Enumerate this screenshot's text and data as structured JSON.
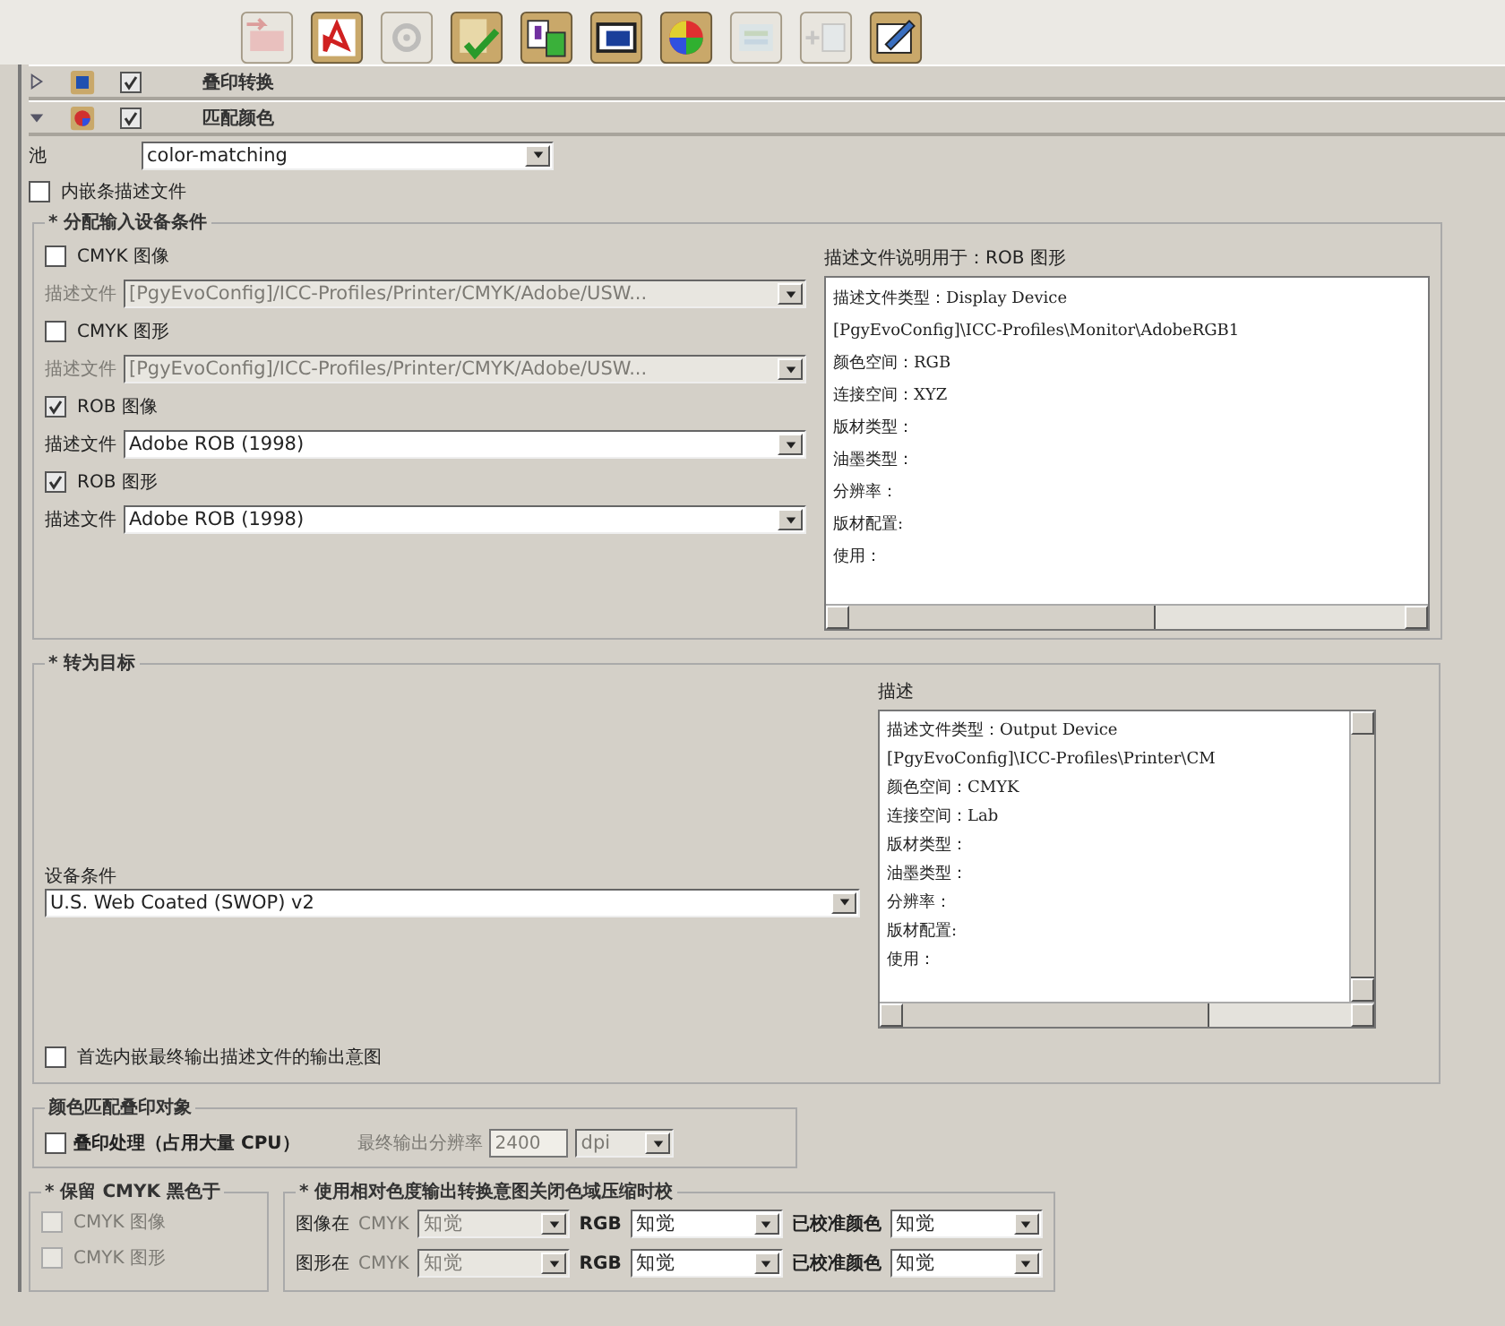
{
  "toolbar": [
    {
      "kind": "export",
      "disabled": true
    },
    {
      "kind": "pdf",
      "disabled": false
    },
    {
      "kind": "target",
      "disabled": true
    },
    {
      "kind": "check",
      "disabled": false
    },
    {
      "kind": "pages",
      "disabled": false
    },
    {
      "kind": "screen",
      "disabled": false
    },
    {
      "kind": "color",
      "disabled": false
    },
    {
      "kind": "layout",
      "disabled": true
    },
    {
      "kind": "insert",
      "disabled": true
    },
    {
      "kind": "edit",
      "disabled": false
    }
  ],
  "sections": [
    {
      "label": "叠印转换",
      "expanded": false,
      "checked": true,
      "kind": "overprint"
    },
    {
      "label": "匹配颜色",
      "expanded": true,
      "checked": true,
      "kind": "color"
    }
  ],
  "filter": {
    "label": "池",
    "value": "color-matching"
  },
  "embed_checkbox": {
    "label": "内嵌条描述文件",
    "checked": false
  },
  "input_group": {
    "title": "* 分配输入设备条件",
    "items": [
      {
        "label": "CMYK 图像",
        "checked": false,
        "field_label": "描述文件",
        "value": "[PgyEvoConfig]/ICC-Profiles/Printer/CMYK/Adobe/USW...",
        "disabled": true
      },
      {
        "label": "CMYK 图形",
        "checked": false,
        "field_label": "描述文件",
        "value": "[PgyEvoConfig]/ICC-Profiles/Printer/CMYK/Adobe/USW...",
        "disabled": true
      },
      {
        "label": "ROB 图像",
        "checked": true,
        "field_label": "描述文件",
        "value": "Adobe ROB (1998)",
        "disabled": false
      },
      {
        "label": "ROB 图形",
        "checked": true,
        "field_label": "描述文件",
        "value": "Adobe ROB (1998)",
        "disabled": false
      }
    ],
    "description": {
      "title": "描述文件说明用于：ROB 图形",
      "lines": [
        "描述文件类型：Display Device",
        "[PgyEvoConfig]\\ICC-Profiles\\Monitor\\AdobeRGB1",
        "颜色空间：RGB",
        "连接空间：XYZ",
        "版材类型：",
        "油墨类型：",
        "分辨率：",
        "版材配置:",
        "使用："
      ]
    }
  },
  "target_group": {
    "title": "* 转为目标",
    "device_label": "设备条件",
    "device_value": "U.S. Web Coated (SWOP) v2",
    "description": {
      "title": "描述",
      "lines": [
        "描述文件类型：Output Device",
        "[PgyEvoConfig]\\ICC-Profiles\\Printer\\CM",
        "颜色空间：CMYK",
        "连接空间：Lab",
        "版材类型：",
        "油墨类型：",
        "分辨率：",
        "版材配置:",
        "使用："
      ]
    },
    "prefer_checkbox": {
      "label": "首选内嵌最终输出描述文件的输出意图",
      "checked": false
    }
  },
  "overprint_group": {
    "title": "颜色匹配叠印对象",
    "checkbox": {
      "label": "叠印处理（占用大量 CPU）",
      "checked": false
    },
    "resolution_label": "最终输出分辨率",
    "resolution_value": "2400",
    "unit": "dpi",
    "disabled": true
  },
  "black_group": {
    "title": "* 保留 CMYK 黑色于",
    "items": [
      {
        "label": "CMYK 图像",
        "checked": false,
        "disabled": true
      },
      {
        "label": "CMYK 图形",
        "checked": false,
        "disabled": true
      }
    ]
  },
  "relative_group": {
    "title": "* 使用相对色度输出转换意图关闭色域压缩时校",
    "rows": [
      {
        "label": "图像在",
        "cmyk_label": "CMYK",
        "cmyk_value": "知觉",
        "cmyk_disabled": true,
        "rgb_label": "RGB",
        "rgb_value": "知觉",
        "calibrated_label": "已校准颜色",
        "calibrated_value": "知觉"
      },
      {
        "label": "图形在",
        "cmyk_label": "CMYK",
        "cmyk_value": "知觉",
        "cmyk_disabled": true,
        "rgb_label": "RGB",
        "rgb_value": "知觉",
        "calibrated_label": "已校准颜色",
        "calibrated_value": "知觉"
      }
    ]
  }
}
